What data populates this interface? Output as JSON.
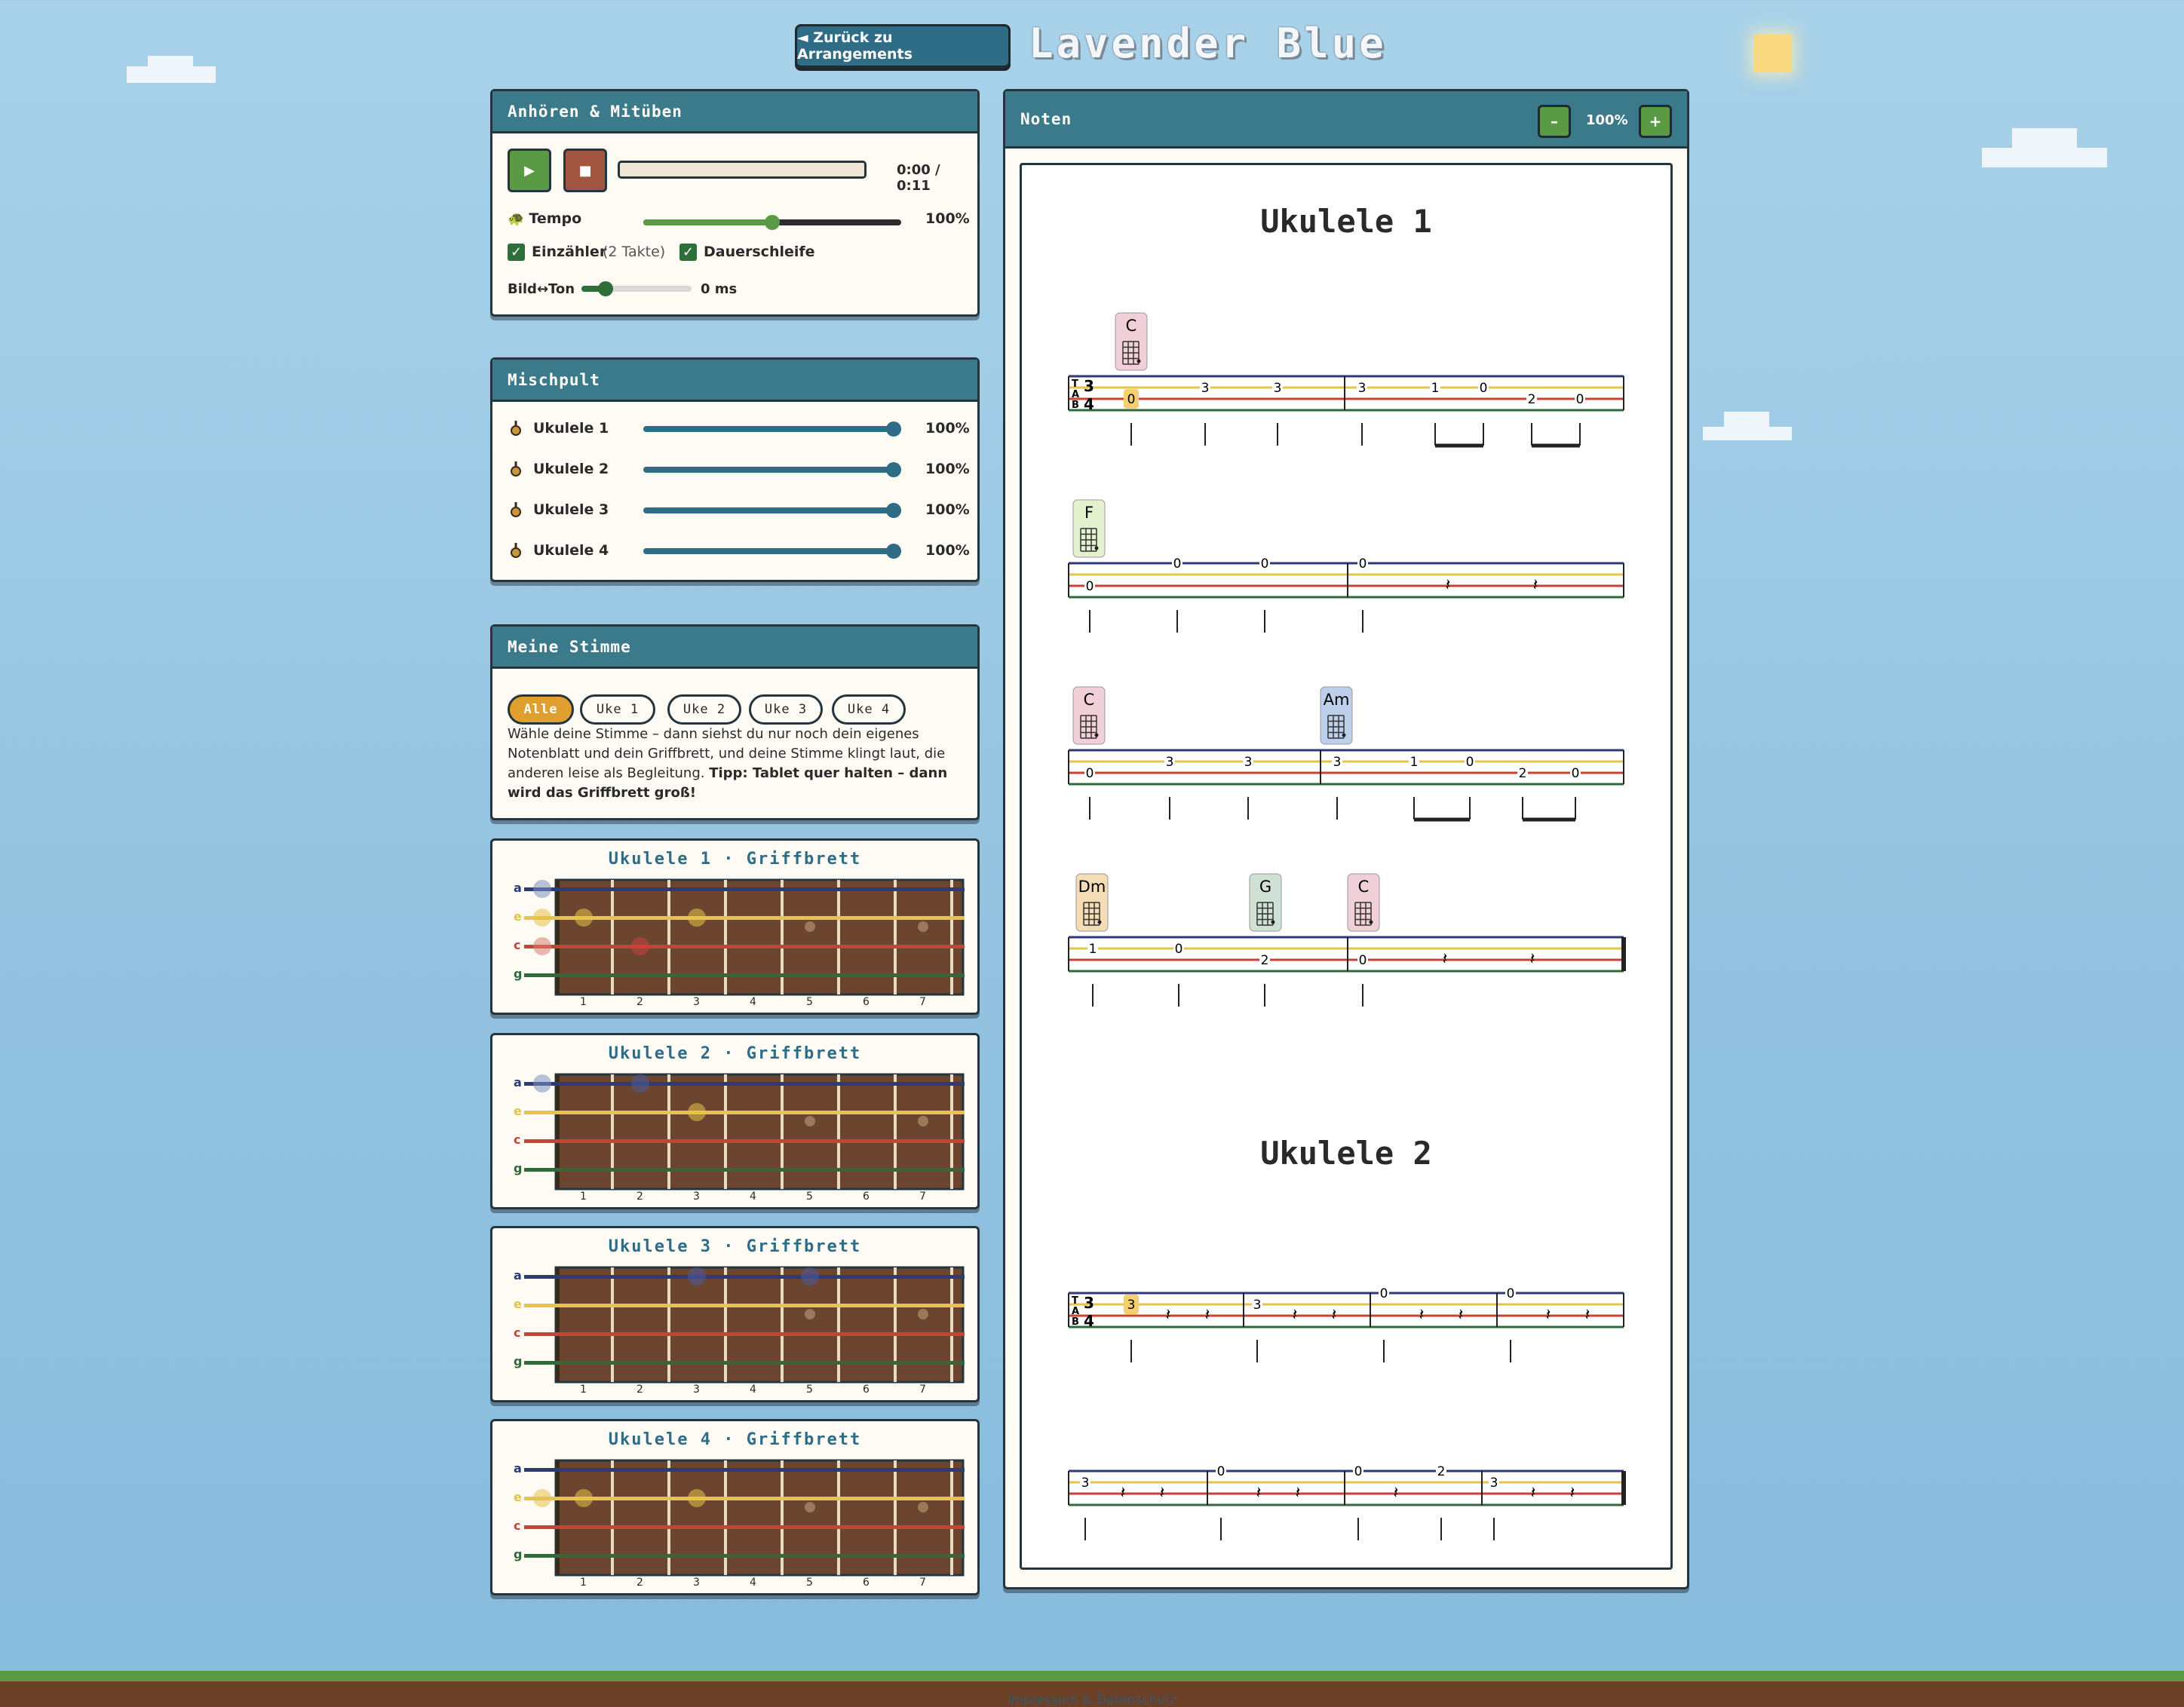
{
  "header": {
    "back_label": "◄ Zurück zu Arrangements",
    "title": "Lavender Blue"
  },
  "player": {
    "title": "Anhören & Mitüben",
    "play_icon": "▶",
    "stop_icon": "■",
    "time": "0:00 / 0:11",
    "tempo_label": "Tempo",
    "tempo_value": "100%",
    "tempo_level": 0.5,
    "countin_label": "Einzähler",
    "countin_detail": "(2 Takte)",
    "loop_label": "Dauerschleife",
    "sync_label": "Bild↔Ton",
    "sync_value": "0 ms"
  },
  "mixer": {
    "title": "Mischpult",
    "channels": [
      {
        "name": "Ukulele 1",
        "value": "100%"
      },
      {
        "name": "Ukulele 2",
        "value": "100%"
      },
      {
        "name": "Ukulele 3",
        "value": "100%"
      },
      {
        "name": "Ukulele 4",
        "value": "100%"
      }
    ]
  },
  "voice": {
    "title": "Meine Stimme",
    "options": [
      "Alle",
      "Uke 1",
      "Uke 2",
      "Uke 3",
      "Uke 4"
    ],
    "selected": "Alle",
    "text": "Wähle deine Stimme – dann siehst du nur noch dein eigenes Notenblatt und dein Griffbrett, und deine Stimme klingt laut, die anderen leise als Begleitung.",
    "tip": "Tipp: Tablet quer halten – dann wird das Griffbrett groß!"
  },
  "fretboards": [
    {
      "title": "Ukulele 1 · Griffbrett"
    },
    {
      "title": "Ukulele 2 · Griffbrett"
    },
    {
      "title": "Ukulele 3 · Griffbrett"
    },
    {
      "title": "Ukulele 4 · Griffbrett"
    }
  ],
  "fretboard_strings": [
    "a",
    "e",
    "c",
    "g"
  ],
  "fret_numbers": [
    "1",
    "2",
    "3",
    "4",
    "5",
    "6",
    "7"
  ],
  "notes_panel": {
    "title": "Noten",
    "zoom_out": "–",
    "zoom_in": "+",
    "zoom": "100%"
  },
  "sheet": {
    "part1_title": "Ukulele 1",
    "part2_title": "Ukulele 2",
    "chords": [
      "C",
      "F",
      "C",
      "Am",
      "Dm",
      "G",
      "C"
    ]
  },
  "footer": {
    "link": "Impressum & Datenschutz"
  },
  "colors": {
    "panel_header": "#3a7a8a",
    "play": "#5a9a45",
    "stop": "#a3563f",
    "accent": "#e0a030",
    "string_a": "#2b3a7a",
    "string_e": "#e6c34a",
    "string_c": "#c8423a",
    "string_g": "#2f6a3a"
  }
}
